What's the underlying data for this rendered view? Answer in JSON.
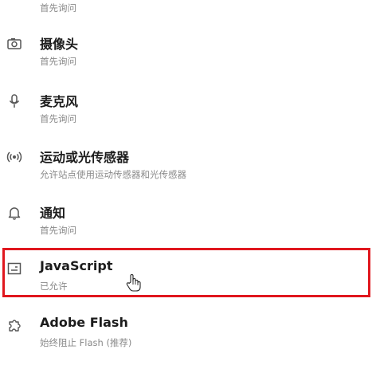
{
  "permissions": [
    {
      "title": "",
      "status": "首先询问",
      "icon": "unknown-icon"
    },
    {
      "title": "摄像头",
      "status": "首先询问",
      "icon": "camera-icon"
    },
    {
      "title": "麦克风",
      "status": "首先询问",
      "icon": "microphone-icon"
    },
    {
      "title": "运动或光传感器",
      "status": "允许站点使用运动传感器和光传感器",
      "icon": "sensor-icon"
    },
    {
      "title": "通知",
      "status": "首先询问",
      "icon": "bell-icon"
    },
    {
      "title": "JavaScript",
      "status": "已允许",
      "icon": "javascript-icon"
    },
    {
      "title": "Adobe Flash",
      "status": "始终阻止 Flash (推荐)",
      "icon": "puzzle-icon"
    }
  ],
  "highlight_color": "#e0171e",
  "highlighted_item": "JavaScript"
}
